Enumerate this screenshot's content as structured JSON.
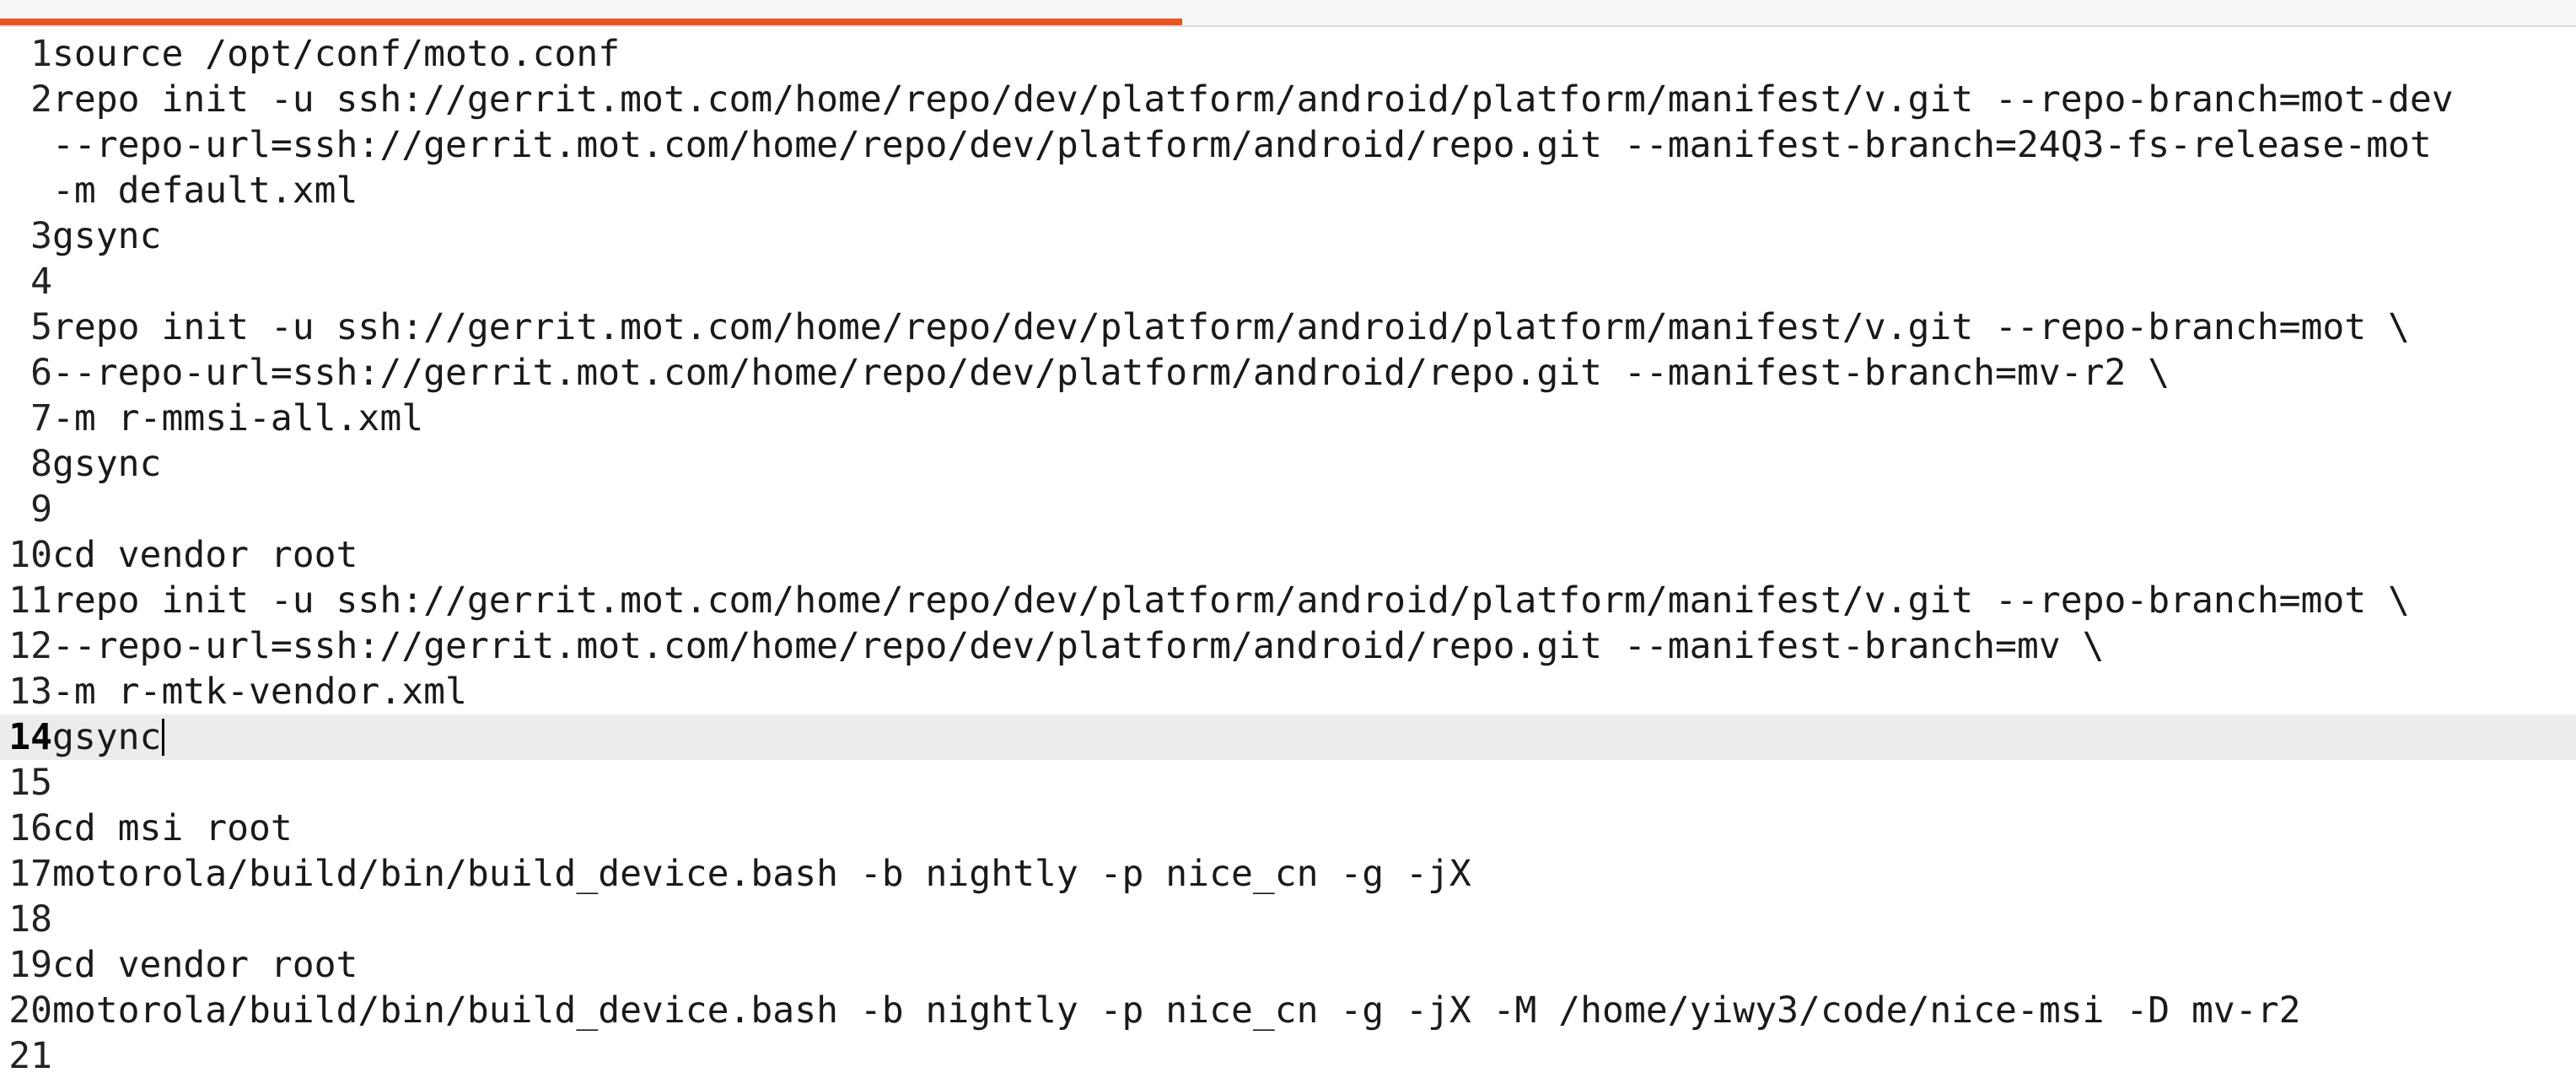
{
  "editor": {
    "current_line": 14,
    "lines": [
      {
        "num": "1",
        "segments": [
          "source /opt/conf/moto.conf"
        ]
      },
      {
        "num": "2",
        "segments": [
          "repo init -u ssh://gerrit.mot.com/home/repo/dev/platform/android/platform/manifest/v.git --repo-branch=mot-dev",
          "--repo-url=ssh://gerrit.mot.com/home/repo/dev/platform/android/repo.git --manifest-branch=24Q3-fs-release-mot",
          "-m default.xml"
        ]
      },
      {
        "num": "3",
        "segments": [
          "gsync"
        ]
      },
      {
        "num": "4",
        "segments": [
          ""
        ]
      },
      {
        "num": "5",
        "segments": [
          "repo init -u ssh://gerrit.mot.com/home/repo/dev/platform/android/platform/manifest/v.git --repo-branch=mot \\"
        ]
      },
      {
        "num": "6",
        "segments": [
          "--repo-url=ssh://gerrit.mot.com/home/repo/dev/platform/android/repo.git --manifest-branch=mv-r2 \\"
        ]
      },
      {
        "num": "7",
        "segments": [
          "-m r-mmsi-all.xml"
        ]
      },
      {
        "num": "8",
        "segments": [
          "gsync"
        ]
      },
      {
        "num": "9",
        "segments": [
          ""
        ]
      },
      {
        "num": "10",
        "segments": [
          "cd vendor root"
        ]
      },
      {
        "num": "11",
        "segments": [
          "repo init -u ssh://gerrit.mot.com/home/repo/dev/platform/android/platform/manifest/v.git --repo-branch=mot \\"
        ]
      },
      {
        "num": "12",
        "segments": [
          "--repo-url=ssh://gerrit.mot.com/home/repo/dev/platform/android/repo.git --manifest-branch=mv \\"
        ]
      },
      {
        "num": "13",
        "segments": [
          "-m r-mtk-vendor.xml"
        ]
      },
      {
        "num": "14",
        "segments": [
          "gsync"
        ]
      },
      {
        "num": "15",
        "segments": [
          ""
        ]
      },
      {
        "num": "16",
        "segments": [
          "cd msi root"
        ]
      },
      {
        "num": "17",
        "segments": [
          "motorola/build/bin/build_device.bash -b nightly -p nice_cn -g -jX"
        ]
      },
      {
        "num": "18",
        "segments": [
          ""
        ]
      },
      {
        "num": "19",
        "segments": [
          "cd vendor root"
        ]
      },
      {
        "num": "20",
        "segments": [
          "motorola/build/bin/build_device.bash -b nightly -p nice_cn -g -jX -M /home/yiwy3/code/nice-msi -D mv-r2"
        ]
      },
      {
        "num": "21",
        "segments": [
          ""
        ]
      }
    ]
  },
  "colors": {
    "accent": "#e95420",
    "current_line_bg": "#ececec",
    "text": "#1a1a1a"
  }
}
